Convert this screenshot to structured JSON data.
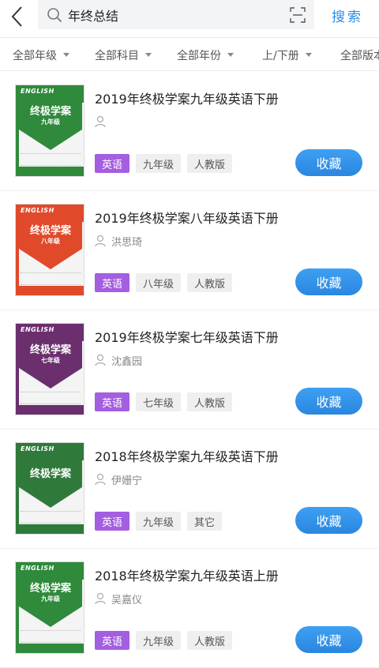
{
  "header": {
    "search_query": "年终总结",
    "search_button": "搜索"
  },
  "filters": [
    {
      "label": "全部年级"
    },
    {
      "label": "全部科目"
    },
    {
      "label": "全部年份"
    },
    {
      "label": "上/下册"
    },
    {
      "label": "全部版本"
    }
  ],
  "results": [
    {
      "title": "2019年终极学案九年级英语下册",
      "author": "",
      "tags": [
        "英语",
        "九年级",
        "人教版"
      ],
      "action": "收藏",
      "cover": {
        "header": "ENGLISH",
        "title": "终极学案",
        "grade": "九年级",
        "color": "#2f8a3c"
      }
    },
    {
      "title": "2019年终极学案八年级英语下册",
      "author": "洪思琦",
      "tags": [
        "英语",
        "八年级",
        "人教版"
      ],
      "action": "收藏",
      "cover": {
        "header": "ENGLISH",
        "title": "终极学案",
        "grade": "八年级",
        "color": "#e04a2a"
      }
    },
    {
      "title": "2019年终极学案七年级英语下册",
      "author": "沈鑫园",
      "tags": [
        "英语",
        "七年级",
        "人教版"
      ],
      "action": "收藏",
      "cover": {
        "header": "ENGLISH",
        "title": "终极学案",
        "grade": "七年级",
        "color": "#6b2f6e"
      }
    },
    {
      "title": "2018年终极学案九年级英语下册",
      "author": "伊姗宁",
      "tags": [
        "英语",
        "九年级",
        "其它"
      ],
      "action": "收藏",
      "cover": {
        "header": "ENGLISH",
        "title": "终极学案",
        "grade": "",
        "color": "#2f7a3a"
      }
    },
    {
      "title": "2018年终极学案九年级英语上册",
      "author": "吴嘉仪",
      "tags": [
        "英语",
        "九年级",
        "人教版"
      ],
      "action": "收藏",
      "cover": {
        "header": "ENGLISH",
        "title": "终极学案",
        "grade": "九年级",
        "color": "#2f8a3c"
      }
    }
  ],
  "colors": {
    "accent": "#2b8de8",
    "subject_tag": "#a45ee0",
    "tag_bg": "#efefef"
  },
  "icons": {
    "back": "back-arrow-icon",
    "search": "search-icon",
    "scan": "scan-icon",
    "user": "user-icon",
    "caret": "caret-down-icon"
  }
}
